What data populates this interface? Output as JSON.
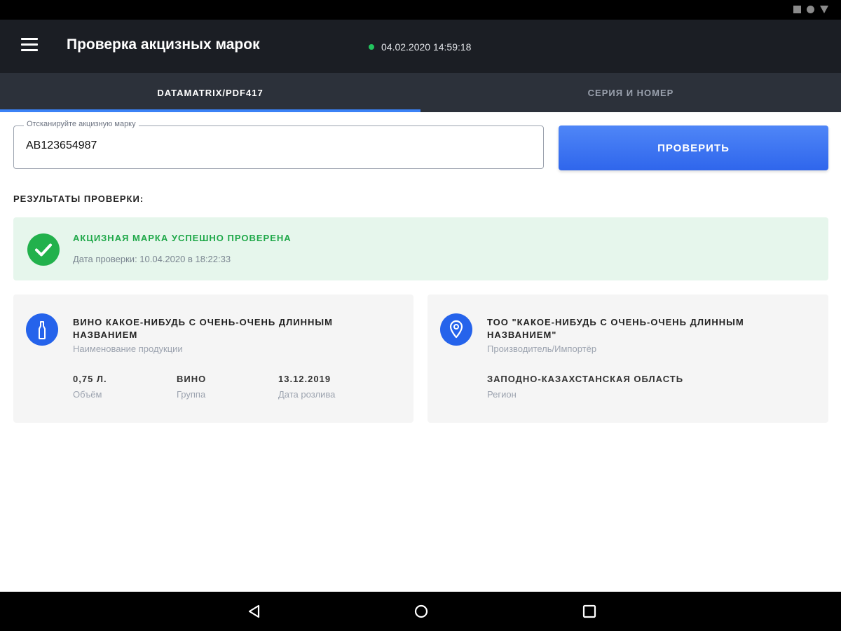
{
  "app": {
    "title": "Проверка акцизных марок",
    "datetime": "04.02.2020 14:59:18"
  },
  "tabs": [
    {
      "label": "DATAMATRIX/PDF417",
      "active": true
    },
    {
      "label": "СЕРИЯ И НОМЕР",
      "active": false
    }
  ],
  "scan": {
    "label": "Отсканируйте акцизную марку",
    "value": "AB123654987",
    "button": "ПРОВЕРИТЬ"
  },
  "results": {
    "title": "РЕЗУЛЬТАТЫ ПРОВЕРКИ:",
    "status_title": "АКЦИЗНАЯ МАРКА УСПЕШНО ПРОВЕРЕНА",
    "status_date": "Дата проверки: 10.04.2020 в 18:22:33"
  },
  "product": {
    "name": "ВИНО КАКОЕ-НИБУДЬ С ОЧЕНЬ-ОЧЕНЬ ДЛИННЫМ НАЗВАНИЕМ",
    "name_label": "Наименование продукции",
    "volume": "0,75 Л.",
    "volume_label": "Объём",
    "group": "ВИНО",
    "group_label": "Группа",
    "bottling_date": "13.12.2019",
    "bottling_date_label": "Дата розлива"
  },
  "producer": {
    "name": "ТОО \"КАКОЕ-НИБУДЬ С ОЧЕНЬ-ОЧЕНЬ ДЛИННЫМ НАЗВАНИЕМ\"",
    "name_label": "Производитель/Импортёр",
    "region": "ЗАПОДНО-КАЗАХСТАНСКАЯ ОБЛАСТЬ",
    "region_label": "Регион"
  },
  "colors": {
    "appbar": "#1b1e24",
    "tabs_bg": "#2c313a",
    "accent": "#3b82f6",
    "success": "#22b14c",
    "success_bg": "#e6f6ec",
    "card_icon": "#2563eb"
  },
  "icons": {
    "menu": "menu-icon",
    "online": "online-status-dot",
    "success": "check-circle-icon",
    "product": "bottle-icon",
    "producer": "location-pin-icon",
    "nav_back": "back-triangle-icon",
    "nav_home": "home-circle-icon",
    "nav_recents": "recents-square-icon"
  }
}
